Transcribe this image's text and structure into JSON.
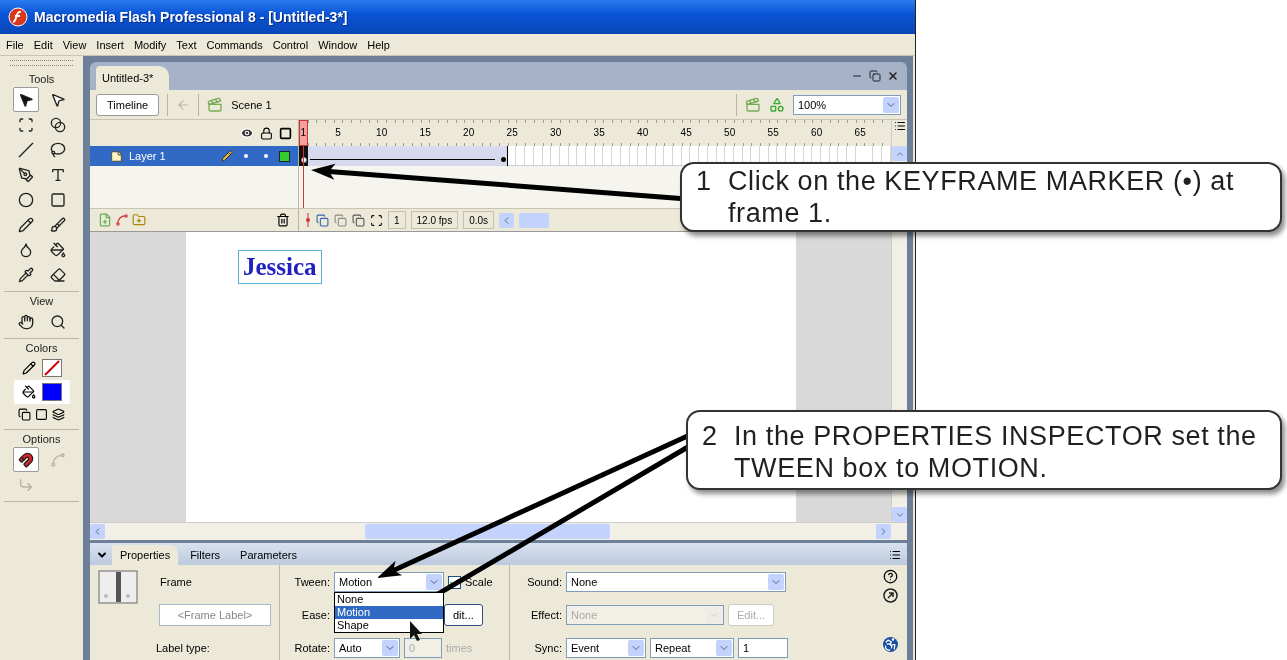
{
  "window": {
    "title": "Macromedia Flash Professional 8 - [Untitled-3*]"
  },
  "menu": [
    "File",
    "Edit",
    "View",
    "Insert",
    "Modify",
    "Text",
    "Commands",
    "Control",
    "Window",
    "Help"
  ],
  "tool_sections": [
    {
      "kind": "tools",
      "title": "Tools",
      "items": [
        {
          "kind": "arrow",
          "selected": true
        },
        {
          "kind": "subselect",
          "selected": false
        },
        {
          "kind": "free-transform",
          "selected": false
        },
        {
          "kind": "gradient",
          "selected": false
        },
        {
          "kind": "line",
          "selected": false
        },
        {
          "kind": "lasso",
          "selected": false
        },
        {
          "kind": "pen",
          "selected": false
        },
        {
          "kind": "text",
          "selected": false
        },
        {
          "kind": "oval",
          "selected": false
        },
        {
          "kind": "rectangle",
          "selected": false
        },
        {
          "kind": "pencil",
          "selected": false
        },
        {
          "kind": "brush",
          "selected": false
        },
        {
          "kind": "ink-bottle",
          "selected": false
        },
        {
          "kind": "paint-bucket",
          "selected": false
        },
        {
          "kind": "eyedropper",
          "selected": false
        },
        {
          "kind": "eraser",
          "selected": false
        }
      ]
    },
    {
      "kind": "tools",
      "title": "View",
      "items": [
        {
          "kind": "hand",
          "selected": false
        },
        {
          "kind": "zoom",
          "selected": false
        }
      ]
    },
    {
      "kind": "colors",
      "title": "Colors"
    },
    {
      "kind": "options",
      "title": "Options",
      "items": [
        {
          "kind": "magnet",
          "selected": true,
          "disabled": false
        },
        {
          "kind": "smooth",
          "selected": false,
          "disabled": true
        },
        {
          "kind": "straighten",
          "selected": false,
          "disabled": true
        }
      ]
    }
  ],
  "colors": {
    "stroke_none": true
  },
  "document": {
    "tab": "Untitled-3*",
    "timeline_button": "Timeline",
    "scene": "Scene 1",
    "zoom": "100%"
  },
  "timeline": {
    "ruler": [
      "1",
      "5",
      "10",
      "15",
      "20",
      "25",
      "30",
      "35",
      "40",
      "45",
      "50",
      "55",
      "60",
      "65"
    ],
    "layers": [
      {
        "name": "Layer 1",
        "selected": true,
        "color": "#33cc33",
        "motion_tween": true
      }
    ],
    "current_frame": "1",
    "fps": "12.0 fps",
    "time": "0.0s"
  },
  "stage": {
    "text": "Jessica"
  },
  "properties": {
    "tabs": [
      {
        "label": "Properties",
        "selected": true
      },
      {
        "label": "Filters",
        "selected": false
      },
      {
        "label": "Parameters",
        "selected": false
      }
    ],
    "frame_heading": "Frame",
    "frame_label_placeholder": "<Frame Label>",
    "label_type": "Label type:",
    "tween": {
      "label": "Tween:",
      "value": "Motion",
      "expanded": true,
      "options": [
        {
          "label": "None",
          "selected": false
        },
        {
          "label": "Motion",
          "selected": true
        },
        {
          "label": "Shape",
          "selected": false
        }
      ]
    },
    "scale": {
      "label": "Scale",
      "checked": true
    },
    "ease": {
      "label": "Ease:",
      "button": "dit..."
    },
    "rotate": {
      "label": "Rotate:",
      "value": "Auto",
      "times_value": "0",
      "times_disabled": true,
      "times_label": "times"
    },
    "sound": {
      "label": "Sound:",
      "value": "None"
    },
    "effect": {
      "label": "Effect:",
      "value": "None",
      "disabled": true,
      "button": "Edit..."
    },
    "sync": {
      "label": "Sync:",
      "value": "Event",
      "repeat": "Repeat",
      "count": "1"
    }
  },
  "callouts": [
    {
      "number": "1",
      "text": "Click on the KEYFRAME MARKER (•) at frame 1."
    },
    {
      "number": "2",
      "text": "In the PROPERTIES INSPECTOR set the TWEEN box to MOTION."
    }
  ]
}
